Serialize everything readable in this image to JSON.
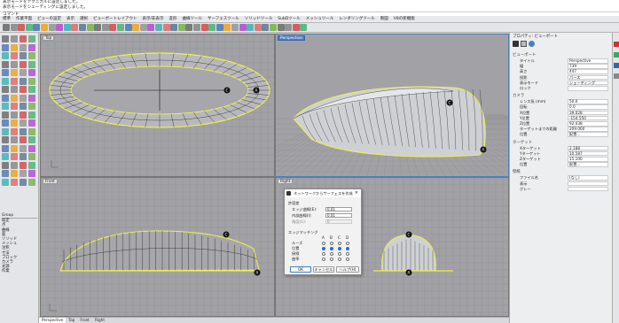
{
  "command": {
    "history_1": "表示モードをテクニカルに設定しました。",
    "history_2": "表示モードをシェーディングに設定しました。",
    "prompt": "コマンド"
  },
  "menu_tabs": [
    "標準",
    "作業平面",
    "ビューの設定",
    "表示",
    "選択",
    "ビューポートレイアウト",
    "表示/非表示",
    "変形",
    "曲線ツール",
    "サーフェスツール",
    "ソリッドツール",
    "SubDツール",
    "メッシュツール",
    "レンダリングツール",
    "製図",
    "V8の新機能"
  ],
  "viewports": {
    "top": "Top",
    "perspective": "Perspective",
    "front": "Front",
    "right": "Right"
  },
  "viewport_tabs": [
    "Perspective",
    "Top",
    "Front",
    "Right"
  ],
  "layers": {
    "title": "Group",
    "items": [
      "既定",
      "点",
      "曲線",
      "面",
      "ソリッド",
      "メッシュ",
      "注釈",
      "寸法",
      "ブロック",
      "カメラ",
      "光源",
      "作業"
    ]
  },
  "panel": {
    "title": "プロパティ: ビューポート",
    "section_viewport": "ビューポート",
    "rows": [
      {
        "k": "タイトル",
        "v": "Perspective"
      },
      {
        "k": "幅",
        "v": "739"
      },
      {
        "k": "高さ",
        "v": "447"
      },
      {
        "k": "投影",
        "v": "パース"
      },
      {
        "k": "表示モード",
        "v": "シェーディング"
      },
      {
        "k": "ロック",
        "v": ""
      }
    ],
    "section_camera": "カメラ",
    "camera_rows": [
      {
        "k": "レンズ長 (mm)",
        "v": "50.0"
      },
      {
        "k": "回転",
        "v": "0.0"
      },
      {
        "k": "X位置",
        "v": "39.028"
      },
      {
        "k": "Y位置",
        "v": "-154.550"
      },
      {
        "k": "Z位置",
        "v": "92.438"
      },
      {
        "k": "ターゲットまでの距離",
        "v": "209.060"
      },
      {
        "k": "位置",
        "v": "配置..."
      }
    ],
    "section_target": "ターゲット",
    "target_rows": [
      {
        "k": "Xターゲット",
        "v": "2.188"
      },
      {
        "k": "Yターゲット",
        "v": "10.587"
      },
      {
        "k": "Zターゲット",
        "v": "15.100"
      },
      {
        "k": "位置",
        "v": "配置..."
      }
    ],
    "section_wallpaper": "壁紙",
    "wall_rows": [
      {
        "k": "ファイル名",
        "v": "(なし)"
      },
      {
        "k": "表示",
        "v": ""
      },
      {
        "k": "グレー",
        "v": ""
      }
    ]
  },
  "dialog": {
    "title": "ネットワークからサーフェスを作成",
    "section_tolerance": "許容差",
    "edge_label": "エッジ曲線(E):",
    "edge_value": "0.01",
    "inner_label": "内部曲線(I):",
    "inner_value": "0.01",
    "angle_label": "角度(G):",
    "angle_value": "0",
    "section_edge": "エッジマッチング",
    "cols": [
      "A",
      "B",
      "C",
      "D"
    ],
    "rows": [
      "ルーズ",
      "位置",
      "接線",
      "曲率"
    ],
    "ok": "OK",
    "cancel": "キャンセル",
    "help": "ヘルプ(H)"
  },
  "colors": {
    "curve": "#f0f04a",
    "mesh": "#000000",
    "surface": "#cfd0d4",
    "active_tab": "#4f7fc0"
  }
}
